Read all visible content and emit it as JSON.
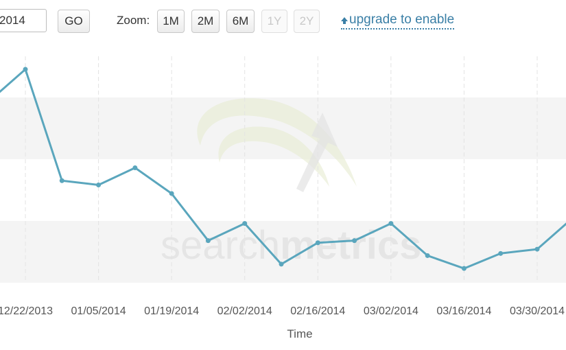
{
  "toolbar": {
    "date_value": "2014",
    "go_label": "GO",
    "zoom_label": "Zoom:",
    "zoom_buttons": [
      {
        "label": "1M",
        "enabled": true
      },
      {
        "label": "2M",
        "enabled": true
      },
      {
        "label": "6M",
        "enabled": true
      },
      {
        "label": "1Y",
        "enabled": false
      },
      {
        "label": "2Y",
        "enabled": false
      }
    ],
    "upgrade_label": "upgrade to enable",
    "upgrade_icon": "arrow-up-icon"
  },
  "watermark": {
    "part1": "search",
    "part2": "metrics"
  },
  "colors": {
    "line": "#5aa6bd",
    "band": "#f4f4f4",
    "link": "#3a7fa6"
  },
  "chart_data": {
    "type": "line",
    "xlabel": "Time",
    "ylabel": "",
    "x_tick_labels": [
      "12/22/2013",
      "01/05/2014",
      "01/19/2014",
      "02/02/2014",
      "02/16/2014",
      "03/02/2014",
      "03/16/2014",
      "03/30/2014"
    ],
    "series": [
      {
        "x": [
          "12/15/2013",
          "12/22/2013",
          "12/29/2013",
          "01/05/2014",
          "01/12/2014",
          "01/19/2014",
          "01/26/2014",
          "02/02/2014",
          "02/09/2014",
          "02/16/2014",
          "02/23/2014",
          "03/02/2014",
          "03/09/2014",
          "03/16/2014",
          "03/23/2014",
          "03/30/2014",
          "04/06/2014"
        ],
        "values": [
          85,
          100,
          48,
          46,
          54,
          42,
          20,
          28,
          9,
          19,
          20,
          28,
          13,
          7,
          14,
          16,
          31
        ]
      }
    ],
    "ylim": [
      0,
      100
    ],
    "grid": true
  }
}
